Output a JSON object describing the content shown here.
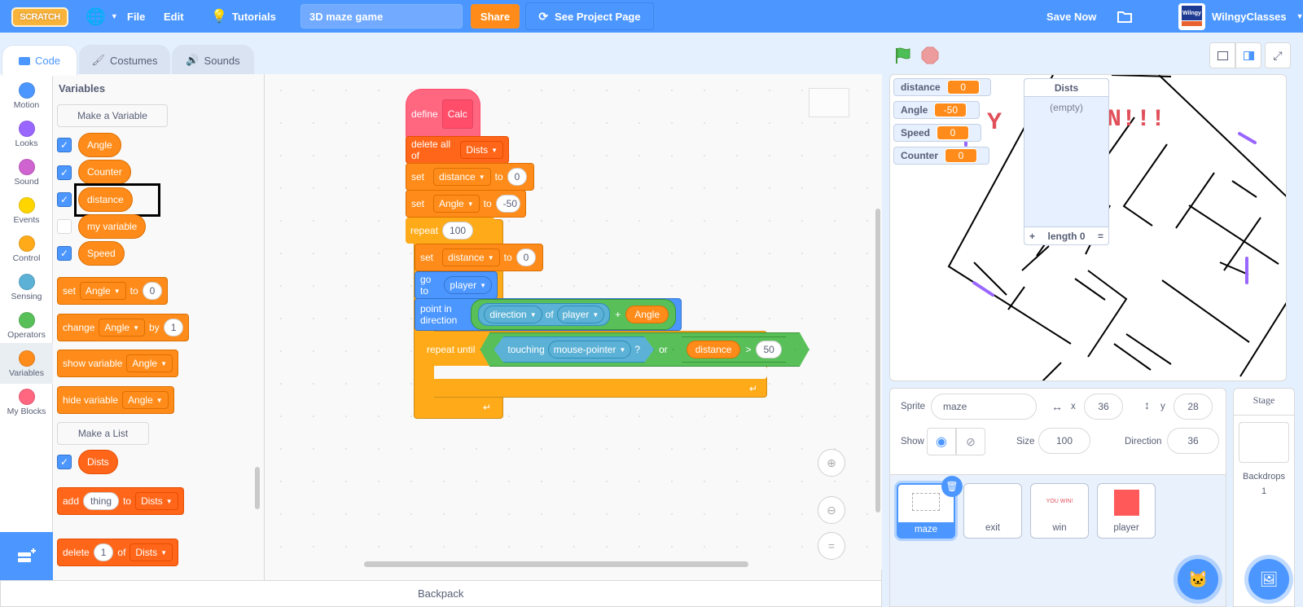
{
  "menubar": {
    "logo": "SCRATCH",
    "language_icon": "globe-icon",
    "file": "File",
    "edit": "Edit",
    "tutorials": "Tutorials",
    "project_title": "3D maze game",
    "share": "Share",
    "see_project_page": "See Project Page",
    "save_now": "Save Now",
    "my_stuff_icon": "folder-icon",
    "username": "WilngyClasses",
    "avatar_text": "Wilngy"
  },
  "tabs": [
    {
      "label": "Code",
      "active": true
    },
    {
      "label": "Costumes",
      "active": false
    },
    {
      "label": "Sounds",
      "active": false
    }
  ],
  "categories": [
    {
      "label": "Motion",
      "color": "#4c97ff"
    },
    {
      "label": "Looks",
      "color": "#9966ff"
    },
    {
      "label": "Sound",
      "color": "#cf63cf"
    },
    {
      "label": "Events",
      "color": "#ffd500"
    },
    {
      "label": "Control",
      "color": "#ffab19"
    },
    {
      "label": "Sensing",
      "color": "#5cb1d6"
    },
    {
      "label": "Operators",
      "color": "#59c059"
    },
    {
      "label": "Variables",
      "color": "#ff8c1a",
      "selected": true
    },
    {
      "label": "My Blocks",
      "color": "#ff6680"
    }
  ],
  "palette": {
    "title": "Variables",
    "make_variable": "Make a Variable",
    "variables": [
      {
        "name": "Angle",
        "checked": true
      },
      {
        "name": "Counter",
        "checked": true
      },
      {
        "name": "distance",
        "checked": true,
        "highlighted": true
      },
      {
        "name": "my variable",
        "checked": false
      },
      {
        "name": "Speed",
        "checked": true
      }
    ],
    "set_block": {
      "label": "set",
      "var": "Angle",
      "to": "to",
      "value": "0"
    },
    "change_block": {
      "label": "change",
      "var": "Angle",
      "by": "by",
      "value": "1"
    },
    "show_block": {
      "label": "show variable",
      "var": "Angle"
    },
    "hide_block": {
      "label": "hide variable",
      "var": "Angle"
    },
    "make_list": "Make a List",
    "lists": [
      {
        "name": "Dists",
        "checked": true
      }
    ],
    "add_block": {
      "label": "add",
      "value": "thing",
      "to": "to",
      "list": "Dists"
    },
    "delete_block": {
      "label": "delete",
      "value": "1",
      "of": "of",
      "list": "Dists"
    }
  },
  "script": {
    "define": {
      "label": "define",
      "name": "Calc"
    },
    "delete_all": {
      "label": "delete all of",
      "list": "Dists"
    },
    "set1": {
      "label": "set",
      "var": "distance",
      "to": "to",
      "value": "0"
    },
    "set2": {
      "label": "set",
      "var": "Angle",
      "to": "to",
      "value": "-50"
    },
    "repeat": {
      "label": "repeat",
      "value": "100"
    },
    "set3": {
      "label": "set",
      "var": "distance",
      "to": "to",
      "value": "0"
    },
    "goto": {
      "label": "go to",
      "target": "player"
    },
    "point": {
      "label": "point in direction",
      "prop": "direction",
      "of": "of",
      "sprite": "player",
      "plus": "+",
      "var": "Angle"
    },
    "repeat_until": {
      "label": "repeat until",
      "touching": "touching",
      "touch_target": "mouse-pointer",
      "q": "?",
      "or": "or",
      "var": "distance",
      "gt": ">",
      "value": "50"
    }
  },
  "canvas": {
    "zoom_in_icon": "zoom-in-icon",
    "zoom_out_icon": "zoom-out-icon",
    "reset_icon": "zoom-reset-icon"
  },
  "backpack": "Backpack",
  "stage": {
    "monitors": [
      {
        "name": "distance",
        "value": "0"
      },
      {
        "name": "Angle",
        "value": "-50"
      },
      {
        "name": "Speed",
        "value": "0"
      },
      {
        "name": "Counter",
        "value": "0"
      }
    ],
    "list_monitor": {
      "title": "Dists",
      "empty": "(empty)",
      "add": "+",
      "length": "length 0",
      "resize": "="
    },
    "overlay_text": "YOU WIN!!!"
  },
  "sprite_info": {
    "sprite_label": "Sprite",
    "sprite_name": "maze",
    "x_label": "x",
    "x": "36",
    "y_label": "y",
    "y": "28",
    "show_label": "Show",
    "size_label": "Size",
    "size": "100",
    "direction_label": "Direction",
    "direction": "36"
  },
  "sprites": [
    {
      "name": "maze",
      "selected": true
    },
    {
      "name": "exit"
    },
    {
      "name": "win"
    },
    {
      "name": "player"
    }
  ],
  "stage_panel": {
    "title": "Stage",
    "backdrops_label": "Backdrops",
    "backdrops_count": "1"
  }
}
